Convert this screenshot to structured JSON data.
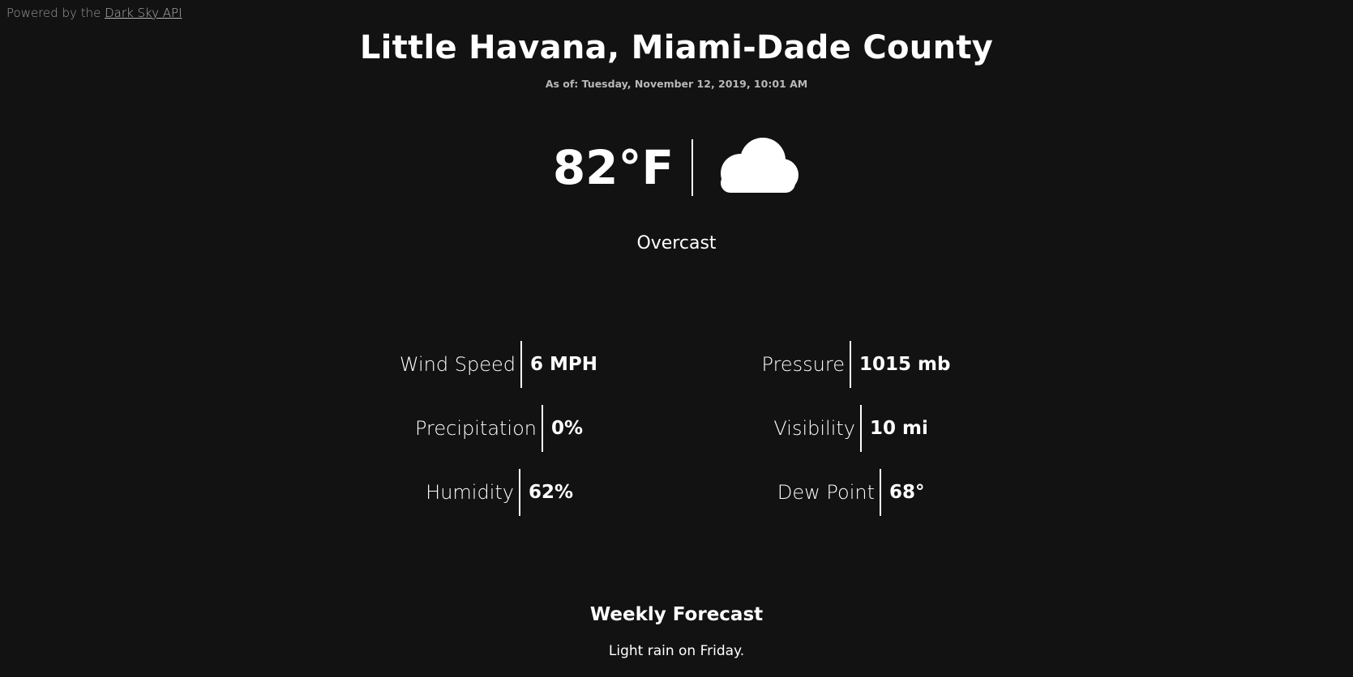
{
  "credit": {
    "prefix": "Powered by the",
    "link_label": "Dark Sky API"
  },
  "location": {
    "title": "Little Havana, Miami-Dade County",
    "as_of": "As of: Tuesday, November 12, 2019, 10:01 AM"
  },
  "current": {
    "temperature": "82°F",
    "icon": "cloud-icon",
    "summary": "Overcast"
  },
  "stats": {
    "wind_speed": {
      "label": "Wind Speed",
      "value": "6 MPH"
    },
    "precipitation": {
      "label": "Precipitation",
      "value": "0%"
    },
    "humidity": {
      "label": "Humidity",
      "value": "62%"
    },
    "pressure": {
      "label": "Pressure",
      "value": "1015 mb"
    },
    "visibility": {
      "label": "Visibility",
      "value": "10 mi"
    },
    "dew_point": {
      "label": "Dew Point",
      "value": "68°"
    }
  },
  "weekly": {
    "title": "Weekly Forecast",
    "summary": "Light rain on Friday."
  },
  "colors": {
    "background": "#121212",
    "text": "#ffffff",
    "muted": "#9a9a9a"
  }
}
